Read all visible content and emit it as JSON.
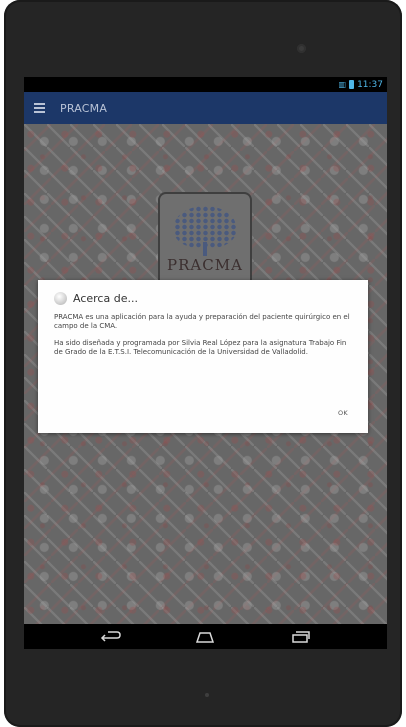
{
  "status_bar": {
    "time": "11:37",
    "signal_icon": "signal-icon",
    "battery_icon": "battery-icon"
  },
  "action_bar": {
    "menu_icon": "hamburger-menu-icon",
    "title": "PRACMA"
  },
  "logo": {
    "text": "PRACMA"
  },
  "dialog": {
    "icon": "info-icon",
    "title": "Acerca de...",
    "paragraphs": [
      "PRACMA es una aplicación para la ayuda y preparación del paciente quirúrgico en el campo de la CMA.",
      "Ha sido diseñada y programada por Silvia Real López para la asignatura Trabajo Fin de Grado de la E.T.S.I. Telecomunicación de la Universidad de Valladolid."
    ],
    "ok_label": "OK"
  },
  "navigation_bar": {
    "back_icon": "back-icon",
    "home_icon": "home-icon",
    "recents_icon": "recents-icon"
  },
  "colors": {
    "action_bar": "#1c3768",
    "status_accent": "#4fb7e8",
    "background_pattern": "#676767",
    "dialog_background": "#fefefe"
  }
}
